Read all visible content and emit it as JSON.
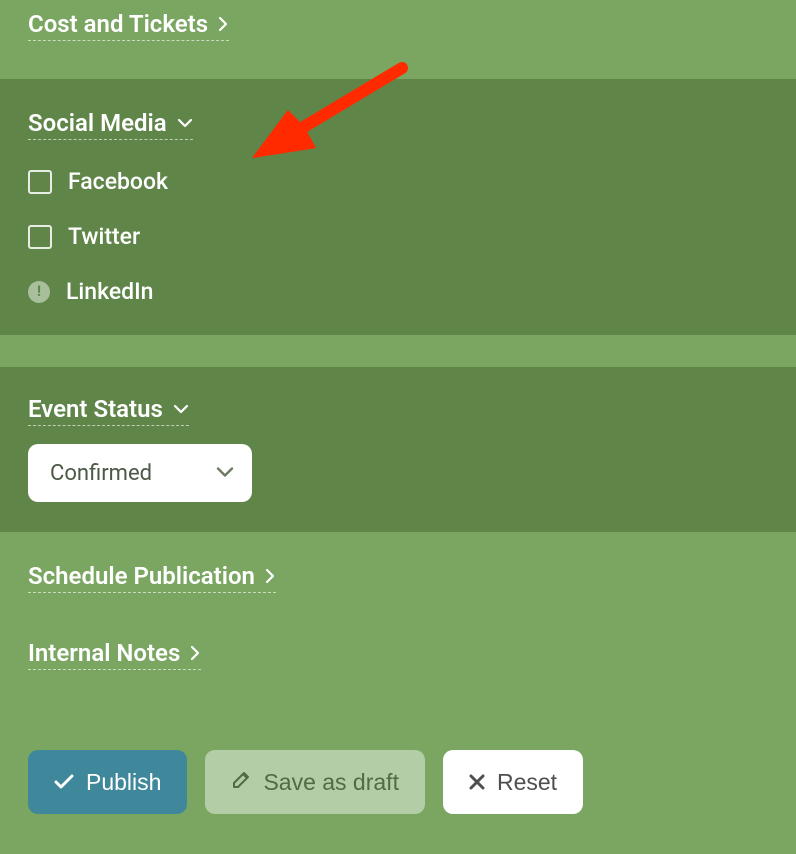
{
  "sections": {
    "cost_tickets": {
      "label": "Cost and Tickets"
    },
    "social_media": {
      "label": "Social Media",
      "options": {
        "facebook": {
          "label": "Facebook",
          "checked": false
        },
        "twitter": {
          "label": "Twitter",
          "checked": false
        },
        "linkedin": {
          "label": "LinkedIn"
        }
      }
    },
    "event_status": {
      "label": "Event Status",
      "selected": "Confirmed"
    },
    "schedule_publication": {
      "label": "Schedule Publication"
    },
    "internal_notes": {
      "label": "Internal Notes"
    }
  },
  "buttons": {
    "publish": "Publish",
    "save_draft": "Save as draft",
    "reset": "Reset"
  },
  "annotation": {
    "type": "arrow",
    "color": "#ff2a00"
  }
}
